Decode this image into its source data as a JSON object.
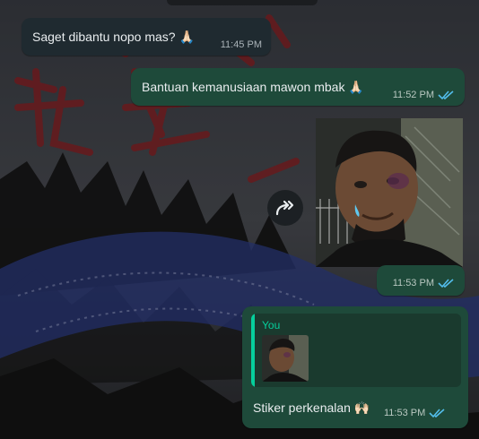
{
  "messages": [
    {
      "text": "Saget dibantu nopo mas? 🙏🏻",
      "time": "11:45 PM"
    },
    {
      "text": "Bantuan kemanusiaan mawon mbak 🙏🏻",
      "time": "11:52 PM"
    },
    {
      "time": "11:53 PM"
    },
    {
      "reply_sender": "You",
      "text": "Stiker perkenalan 🙌🏻",
      "time": "11:53 PM"
    }
  ],
  "icons": {
    "forward": "forward-icon",
    "read_receipt": "double-check-icon"
  },
  "colors": {
    "outgoing_bubble": "#1e4a3a",
    "incoming_bubble": "#1f2a30",
    "read_tick": "#53bdeb",
    "reply_accent": "#06cf9c"
  }
}
